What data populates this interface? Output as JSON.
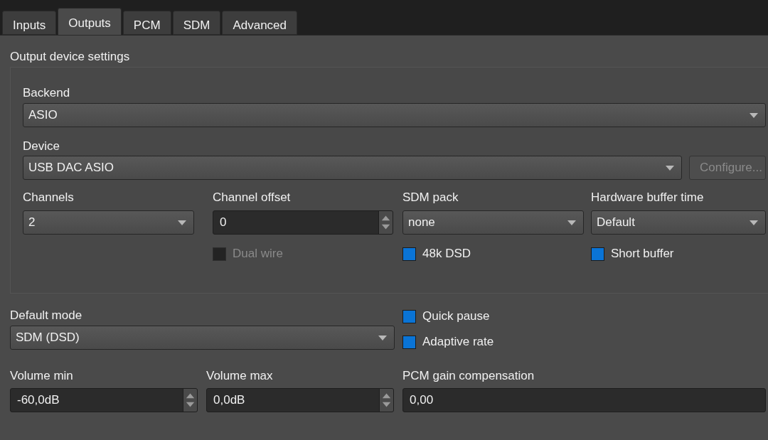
{
  "tabs": [
    {
      "label": "Inputs",
      "selected": false
    },
    {
      "label": "Outputs",
      "selected": true
    },
    {
      "label": "PCM",
      "selected": false
    },
    {
      "label": "SDM",
      "selected": false
    },
    {
      "label": "Advanced",
      "selected": false
    }
  ],
  "output_device_settings": {
    "title": "Output device settings",
    "backend": {
      "label": "Backend",
      "value": "ASIO"
    },
    "device": {
      "label": "Device",
      "value": "USB DAC ASIO",
      "configure_button": {
        "label": "Configure...",
        "disabled": true
      }
    },
    "fields": [
      {
        "kind": "combo",
        "label": "Channels",
        "value": "2"
      },
      {
        "kind": "spin",
        "label": "Channel offset",
        "value": "0",
        "checkbox": {
          "label": "Dual wire",
          "checked": false,
          "disabled": true
        }
      },
      {
        "kind": "combo",
        "label": "SDM pack",
        "value": "none",
        "checkbox": {
          "label": "48k DSD",
          "checked": true,
          "disabled": false
        }
      },
      {
        "kind": "combo",
        "label": "Hardware buffer time",
        "value": "Default",
        "checkbox": {
          "label": "Short buffer",
          "checked": true,
          "disabled": false
        }
      }
    ]
  },
  "default_mode": {
    "label": "Default mode",
    "value": "SDM (DSD)"
  },
  "options": [
    {
      "label": "Quick pause",
      "checked": true,
      "disabled": false
    },
    {
      "label": "Adaptive rate",
      "checked": true,
      "disabled": false
    }
  ],
  "volume_fields": [
    {
      "kind": "spin",
      "label": "Volume min",
      "value": "-60,0dB"
    },
    {
      "kind": "spin",
      "label": "Volume max",
      "value": "0,0dB"
    },
    {
      "kind": "field",
      "label": "PCM gain compensation",
      "value": "0,00"
    }
  ]
}
